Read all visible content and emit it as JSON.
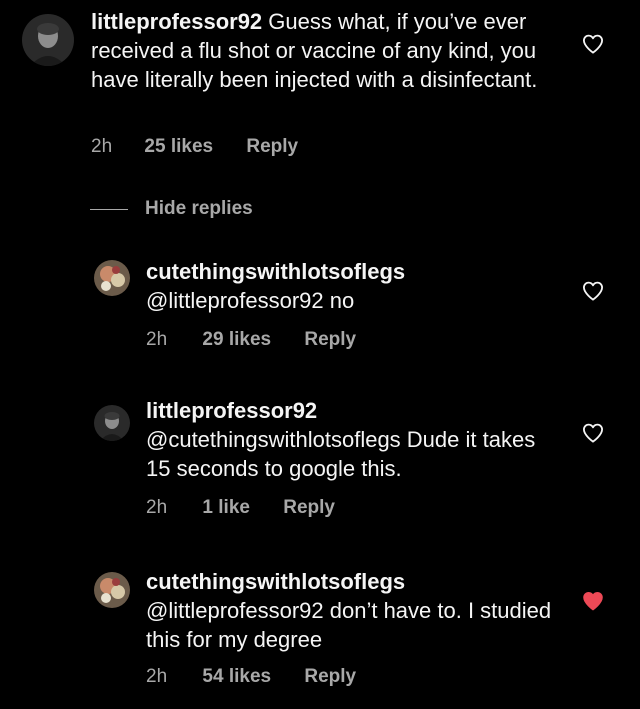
{
  "colors": {
    "background": "#000000",
    "text": "#f5f5f5",
    "muted": "#a8a8a8",
    "liked_heart": "#ed4956"
  },
  "comments": [
    {
      "username": "littleprofessor92",
      "text": "Guess what, if you’ve ever received a flu shot or vaccine of any kind, you have literally been injected with a disinfectant.",
      "time": "2h",
      "likes": "25 likes",
      "reply_label": "Reply",
      "heart_icon": "heart-outline-icon",
      "liked": false
    },
    {
      "username": "cutethingswithlotsoflegs",
      "text": "@littleprofessor92 no",
      "time": "2h",
      "likes": "29 likes",
      "reply_label": "Reply",
      "heart_icon": "heart-outline-icon",
      "liked": false
    },
    {
      "username": "littleprofessor92",
      "text": "@cutethingswithlotsoflegs Dude it takes 15 seconds to google this.",
      "time": "2h",
      "likes": "1 like",
      "reply_label": "Reply",
      "heart_icon": "heart-outline-icon",
      "liked": false
    },
    {
      "username": "cutethingswithlotsoflegs",
      "text": "@littleprofessor92 don’t have to. I studied this for my degree",
      "time": "2h",
      "likes": "54 likes",
      "reply_label": "Reply",
      "heart_icon": "heart-filled-icon",
      "liked": true
    }
  ],
  "replies_toggle": {
    "label": "Hide replies"
  }
}
